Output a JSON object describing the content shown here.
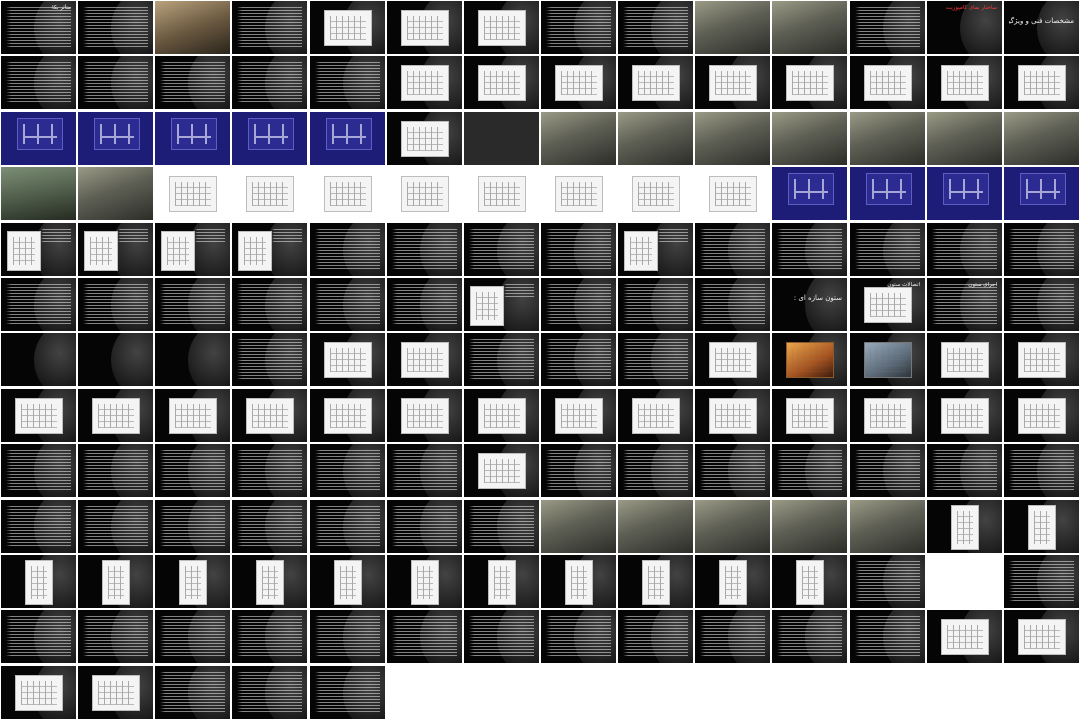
{
  "view": "slide-sorter",
  "slide_count": 173,
  "columns": 14,
  "themes": {
    "dark": "#050505",
    "blue": "#1d1d78",
    "white": "#ffffff",
    "accent_red": "#ff3b3b"
  },
  "slide_kinds": [
    "text",
    "text",
    "photo-diagram",
    "text",
    "figure",
    "figure",
    "figure",
    "text",
    "text",
    "photo",
    "photo",
    "text",
    "title-red",
    "title-big",
    "text",
    "text",
    "text",
    "text",
    "text",
    "figure",
    "figure",
    "figure",
    "figure",
    "figure",
    "figure",
    "figure",
    "figure",
    "figure",
    "blue",
    "blue",
    "blue",
    "blue",
    "blue",
    "figure",
    "grey",
    "photo",
    "photo",
    "photo",
    "photo",
    "photo",
    "photo",
    "photo",
    "photo-green",
    "photo",
    "white-figure",
    "white-figure",
    "white-figure",
    "white-figure",
    "white-figure",
    "white-figure",
    "white-figure",
    "white-figure",
    "blue",
    "blue",
    "blue",
    "blue",
    "text-figure",
    "text-figure",
    "text-figure",
    "text-figure",
    "text",
    "text",
    "text",
    "text",
    "text-figure",
    "text",
    "text",
    "text",
    "text",
    "text",
    "text",
    "text",
    "text",
    "text",
    "text",
    "text",
    "text-figure",
    "text",
    "text",
    "text",
    "title",
    "grid",
    "text",
    "text",
    "title",
    "title",
    "title",
    "text",
    "figure",
    "figure",
    "text",
    "text",
    "text",
    "figure",
    "pic-hot",
    "pic-cool",
    "figure",
    "figure",
    "figure",
    "figure",
    "figure",
    "figure",
    "figure",
    "figure",
    "figure",
    "figure",
    "figure",
    "figure",
    "figure",
    "figure",
    "figure",
    "figure",
    "text",
    "text",
    "text",
    "text",
    "text",
    "text",
    "figure",
    "text",
    "text",
    "text",
    "text",
    "text",
    "text",
    "text",
    "text",
    "text",
    "text",
    "text",
    "text",
    "text",
    "text",
    "photo",
    "photo",
    "photo",
    "photo",
    "photo",
    "tall-figure",
    "tall-figure",
    "tall-figure",
    "tall-figure",
    "tall-figure",
    "tall-figure",
    "tall-figure",
    "tall-figure",
    "tall-figure",
    "tall-figure",
    "tall-figure",
    "tall-figure",
    "tall-figure",
    "text",
    "blank-white",
    "text",
    "text",
    "text",
    "text",
    "text",
    "text",
    "text",
    "text",
    "text",
    "text",
    "text",
    "text",
    "text",
    "figure",
    "figure",
    "figure",
    "figure",
    "text",
    "text"
  ],
  "slide_titles": {
    "0": "متأثر بكا",
    "12": "ساختار نمای کامپوزیت",
    "13": "مشخصات فنی و ویژگیهای پنل کامپوزیت بانل",
    "80": "ستون سازه ای :",
    "81": "اتصالات ستون",
    "82": "اجرای ستون"
  }
}
